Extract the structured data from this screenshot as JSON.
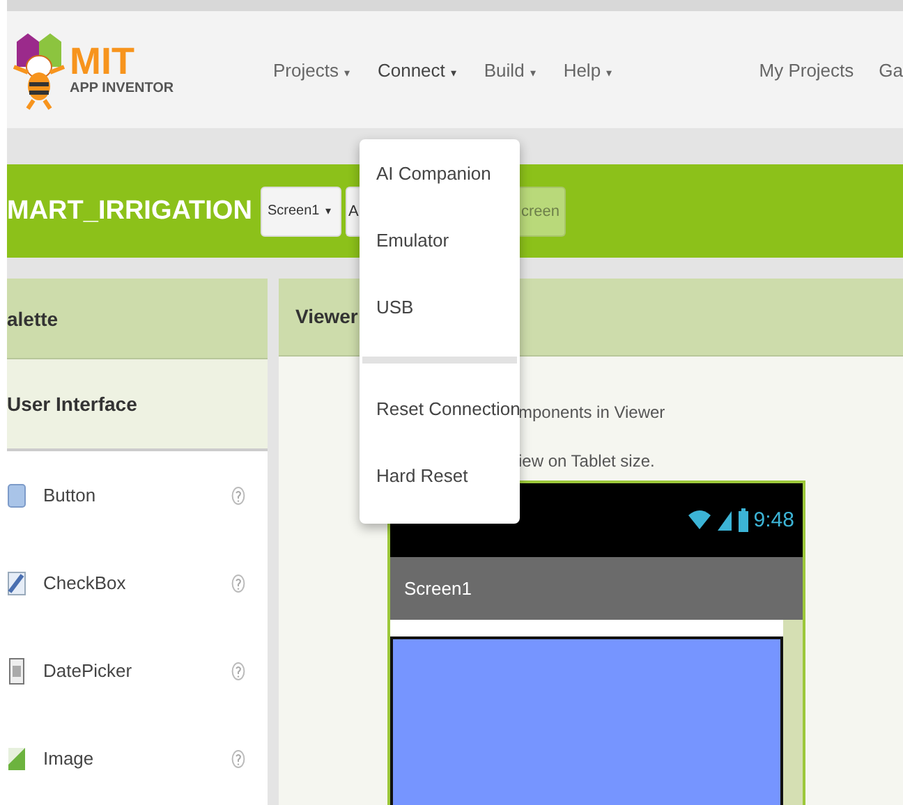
{
  "header": {
    "logo": {
      "title": "MIT",
      "subtitle": "APP INVENTOR"
    },
    "menus": [
      {
        "label": "Projects",
        "caret": "▾",
        "expanded": false
      },
      {
        "label": "Connect",
        "caret": "▾",
        "expanded": true
      },
      {
        "label": "Build",
        "caret": "▾",
        "expanded": false
      },
      {
        "label": "Help",
        "caret": "▾",
        "expanded": false
      }
    ],
    "links": [
      "My Projects",
      "Ga"
    ]
  },
  "project": {
    "name": "MART_IRRIGATION",
    "buttons": [
      {
        "label": "Screen1",
        "caret": "▾",
        "kind": "dropdown"
      },
      {
        "label": "A",
        "kind": "plain"
      },
      {
        "label": "creen",
        "kind": "faded"
      }
    ]
  },
  "palette": {
    "title": "alette",
    "section": "User Interface",
    "items": [
      {
        "name": "Button",
        "kind": "button"
      },
      {
        "name": "CheckBox",
        "kind": "checkbox"
      },
      {
        "name": "DatePicker",
        "kind": "datepicker"
      },
      {
        "name": "Image",
        "kind": "image"
      }
    ]
  },
  "viewer": {
    "title": "Viewer",
    "notes": [
      "mponents in Viewer",
      "iew on Tablet size."
    ],
    "phone": {
      "time": "9:48",
      "screen_title": "Screen1"
    }
  },
  "connect_menu": {
    "groups": [
      [
        {
          "label": "AI Companion"
        },
        {
          "label": "Emulator"
        },
        {
          "label": "USB"
        }
      ],
      [
        {
          "label": "Reset Connection"
        },
        {
          "label": "Hard Reset"
        }
      ]
    ]
  }
}
